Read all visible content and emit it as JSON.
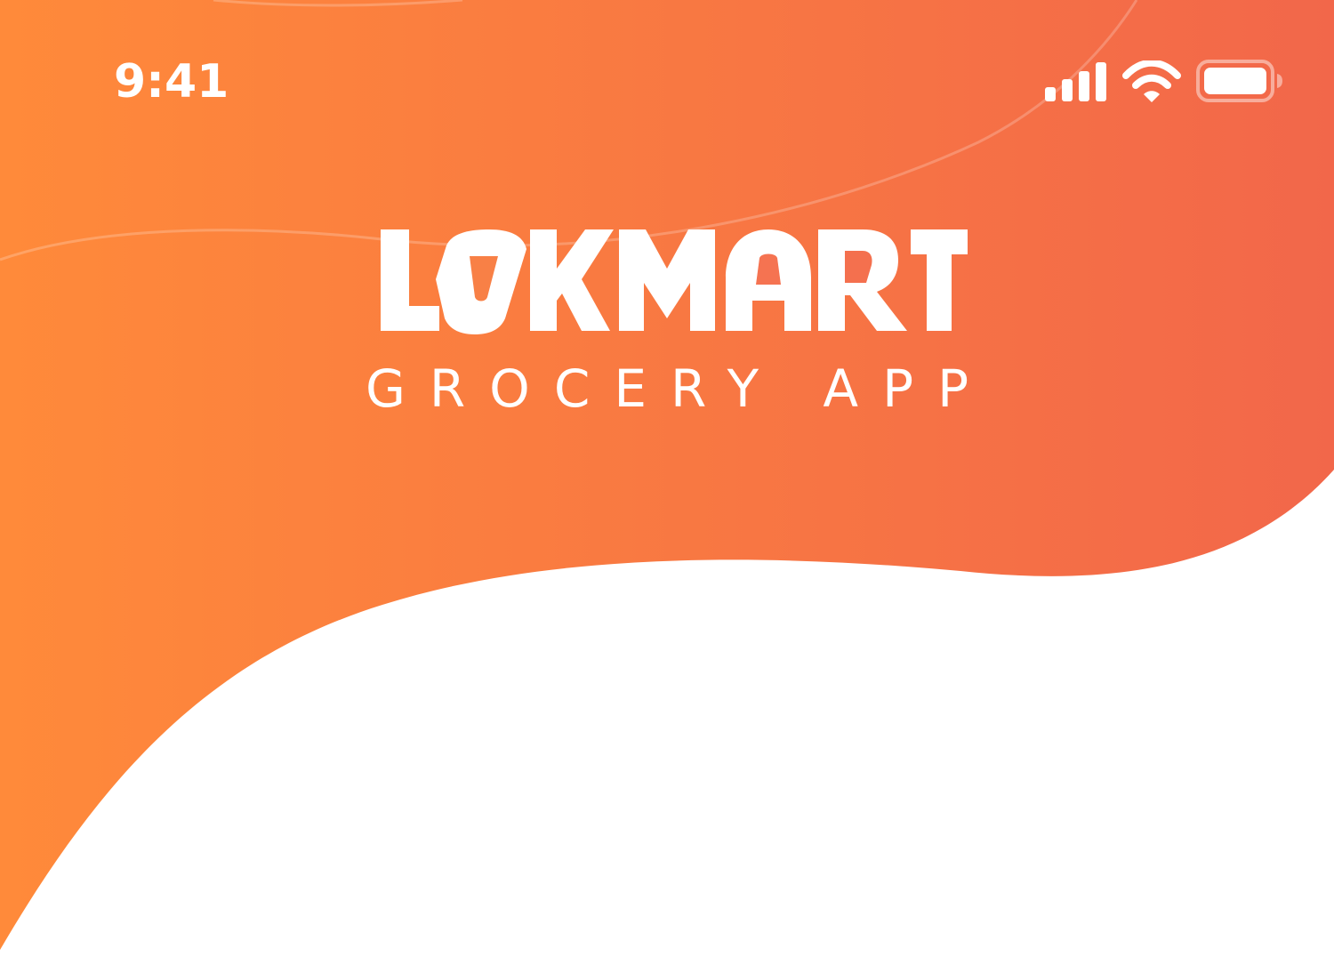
{
  "status_bar": {
    "time": "9:41",
    "icons": [
      "signal-icon",
      "wifi-icon",
      "battery-icon"
    ]
  },
  "brand": {
    "logo_text": "LOKMART",
    "subtitle": "GROCERY APP"
  },
  "colors": {
    "gradient_start": "#FF8A3A",
    "gradient_end": "#F2674A",
    "text": "#FFFFFF",
    "background": "#FFFFFF"
  }
}
